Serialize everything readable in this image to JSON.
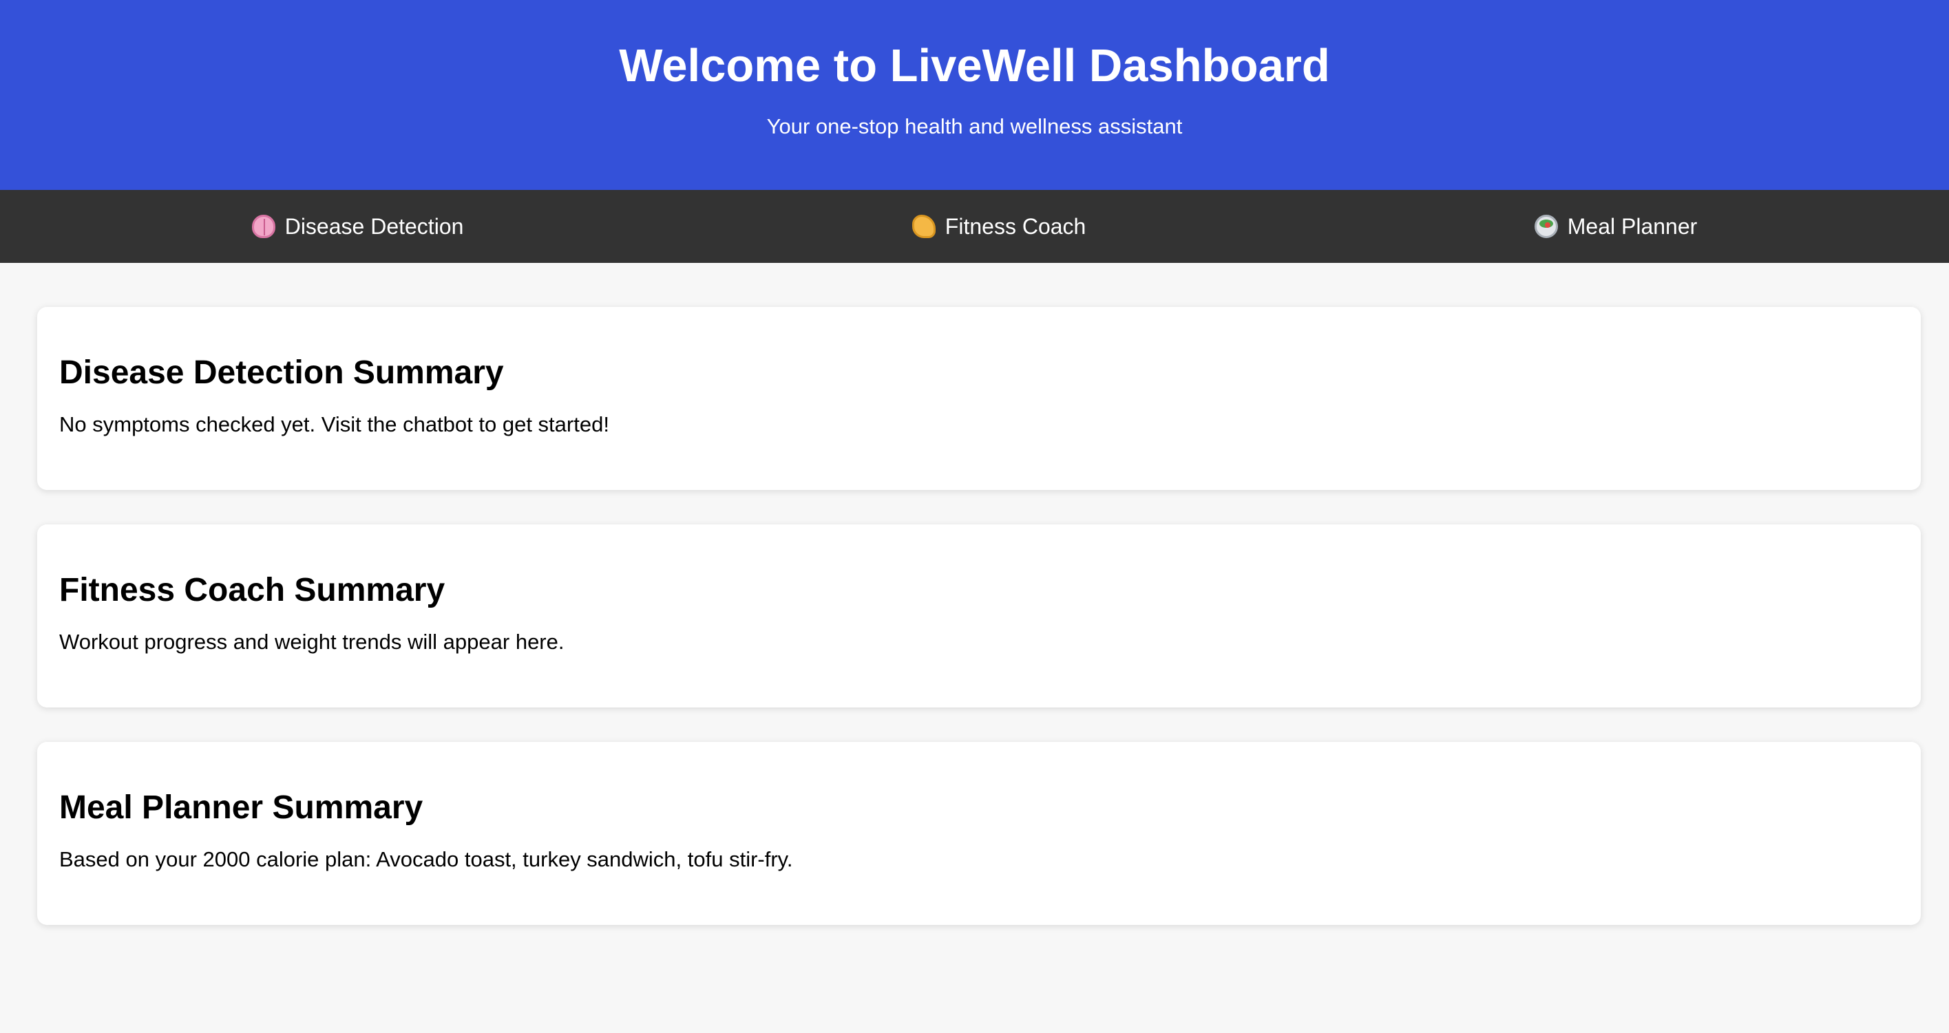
{
  "header": {
    "title": "Welcome to LiveWell Dashboard",
    "subtitle": "Your one-stop health and wellness assistant",
    "background_color": "#3451d9"
  },
  "nav": {
    "background_color": "#333333",
    "items": [
      {
        "label": "Disease Detection",
        "icon": "brain-icon"
      },
      {
        "label": "Fitness Coach",
        "icon": "flexed-biceps-icon"
      },
      {
        "label": "Meal Planner",
        "icon": "salad-bowl-icon"
      }
    ]
  },
  "cards": [
    {
      "title": "Disease Detection Summary",
      "text": "No symptoms checked yet. Visit the chatbot to get started!"
    },
    {
      "title": "Fitness Coach Summary",
      "text": "Workout progress and weight trends will appear here."
    },
    {
      "title": "Meal Planner Summary",
      "text": "Based on your 2000 calorie plan: Avocado toast, turkey sandwich, tofu stir-fry."
    }
  ]
}
